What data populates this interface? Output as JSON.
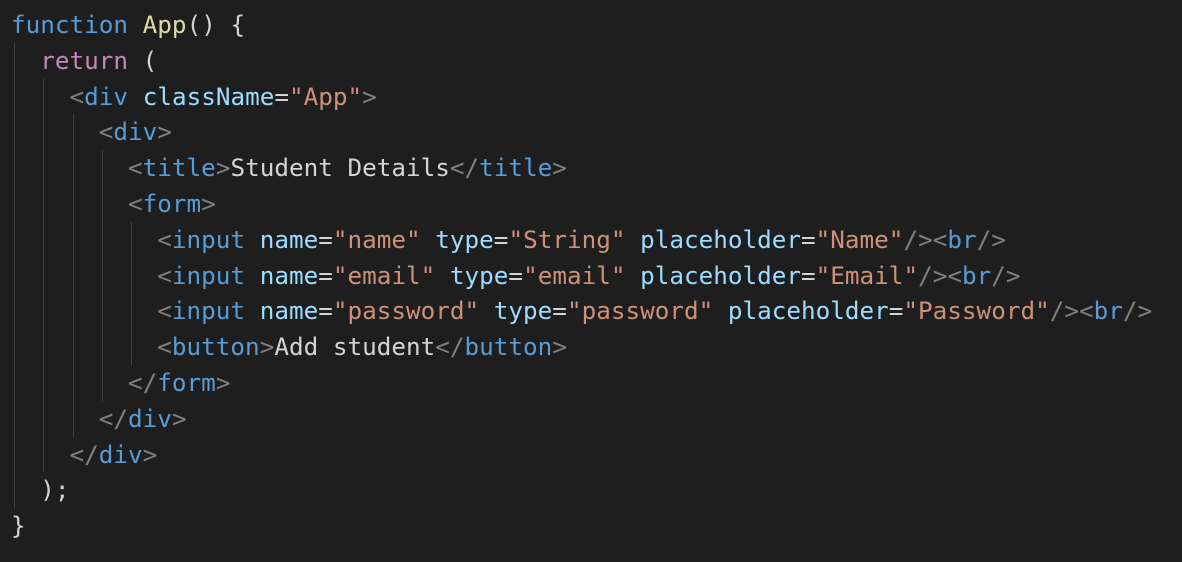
{
  "colors": {
    "background": "#1e1e1e",
    "keyword": "#569cd6",
    "control": "#c586c0",
    "function": "#dcdcaa",
    "plain": "#d4d4d4",
    "punct": "#808080",
    "tag": "#569cd6",
    "attr": "#9cdcfe",
    "string": "#ce9178",
    "text": "#d4d4d4",
    "indent_guide": "#404040"
  },
  "code_lines": [
    {
      "indent": 0,
      "tokens": [
        {
          "t": "keyword",
          "v": "function"
        },
        {
          "t": "plain",
          "v": " "
        },
        {
          "t": "function",
          "v": "App"
        },
        {
          "t": "plain",
          "v": "() {"
        }
      ]
    },
    {
      "indent": 1,
      "tokens": [
        {
          "t": "control",
          "v": "return"
        },
        {
          "t": "plain",
          "v": " ("
        }
      ]
    },
    {
      "indent": 2,
      "tokens": [
        {
          "t": "punct",
          "v": "<"
        },
        {
          "t": "tag",
          "v": "div"
        },
        {
          "t": "plain",
          "v": " "
        },
        {
          "t": "attr",
          "v": "className"
        },
        {
          "t": "plain",
          "v": "="
        },
        {
          "t": "string",
          "v": "\"App\""
        },
        {
          "t": "punct",
          "v": ">"
        }
      ]
    },
    {
      "indent": 3,
      "tokens": [
        {
          "t": "punct",
          "v": "<"
        },
        {
          "t": "tag",
          "v": "div"
        },
        {
          "t": "punct",
          "v": ">"
        }
      ]
    },
    {
      "indent": 4,
      "tokens": [
        {
          "t": "punct",
          "v": "<"
        },
        {
          "t": "tag",
          "v": "title"
        },
        {
          "t": "punct",
          "v": ">"
        },
        {
          "t": "text",
          "v": "Student Details"
        },
        {
          "t": "punct",
          "v": "</"
        },
        {
          "t": "tag",
          "v": "title"
        },
        {
          "t": "punct",
          "v": ">"
        }
      ]
    },
    {
      "indent": 4,
      "tokens": [
        {
          "t": "punct",
          "v": "<"
        },
        {
          "t": "tag",
          "v": "form"
        },
        {
          "t": "punct",
          "v": ">"
        }
      ]
    },
    {
      "indent": 5,
      "tokens": [
        {
          "t": "punct",
          "v": "<"
        },
        {
          "t": "tag",
          "v": "input"
        },
        {
          "t": "plain",
          "v": " "
        },
        {
          "t": "attr",
          "v": "name"
        },
        {
          "t": "plain",
          "v": "="
        },
        {
          "t": "string",
          "v": "\"name\""
        },
        {
          "t": "plain",
          "v": " "
        },
        {
          "t": "attr",
          "v": "type"
        },
        {
          "t": "plain",
          "v": "="
        },
        {
          "t": "string",
          "v": "\"String\""
        },
        {
          "t": "plain",
          "v": " "
        },
        {
          "t": "attr",
          "v": "placeholder"
        },
        {
          "t": "plain",
          "v": "="
        },
        {
          "t": "string",
          "v": "\"Name\""
        },
        {
          "t": "punct",
          "v": "/><"
        },
        {
          "t": "tag",
          "v": "br"
        },
        {
          "t": "punct",
          "v": "/>"
        }
      ]
    },
    {
      "indent": 5,
      "tokens": [
        {
          "t": "punct",
          "v": "<"
        },
        {
          "t": "tag",
          "v": "input"
        },
        {
          "t": "plain",
          "v": " "
        },
        {
          "t": "attr",
          "v": "name"
        },
        {
          "t": "plain",
          "v": "="
        },
        {
          "t": "string",
          "v": "\"email\""
        },
        {
          "t": "plain",
          "v": " "
        },
        {
          "t": "attr",
          "v": "type"
        },
        {
          "t": "plain",
          "v": "="
        },
        {
          "t": "string",
          "v": "\"email\""
        },
        {
          "t": "plain",
          "v": " "
        },
        {
          "t": "attr",
          "v": "placeholder"
        },
        {
          "t": "plain",
          "v": "="
        },
        {
          "t": "string",
          "v": "\"Email\""
        },
        {
          "t": "punct",
          "v": "/><"
        },
        {
          "t": "tag",
          "v": "br"
        },
        {
          "t": "punct",
          "v": "/>"
        }
      ]
    },
    {
      "indent": 5,
      "tokens": [
        {
          "t": "punct",
          "v": "<"
        },
        {
          "t": "tag",
          "v": "input"
        },
        {
          "t": "plain",
          "v": " "
        },
        {
          "t": "attr",
          "v": "name"
        },
        {
          "t": "plain",
          "v": "="
        },
        {
          "t": "string",
          "v": "\"password\""
        },
        {
          "t": "plain",
          "v": " "
        },
        {
          "t": "attr",
          "v": "type"
        },
        {
          "t": "plain",
          "v": "="
        },
        {
          "t": "string",
          "v": "\"password\""
        },
        {
          "t": "plain",
          "v": " "
        },
        {
          "t": "attr",
          "v": "placeholder"
        },
        {
          "t": "plain",
          "v": "="
        },
        {
          "t": "string",
          "v": "\"Password\""
        },
        {
          "t": "punct",
          "v": "/><"
        },
        {
          "t": "tag",
          "v": "br"
        },
        {
          "t": "punct",
          "v": "/>"
        }
      ]
    },
    {
      "indent": 5,
      "tokens": [
        {
          "t": "punct",
          "v": "<"
        },
        {
          "t": "tag",
          "v": "button"
        },
        {
          "t": "punct",
          "v": ">"
        },
        {
          "t": "text",
          "v": "Add student"
        },
        {
          "t": "punct",
          "v": "</"
        },
        {
          "t": "tag",
          "v": "button"
        },
        {
          "t": "punct",
          "v": ">"
        }
      ]
    },
    {
      "indent": 4,
      "tokens": [
        {
          "t": "punct",
          "v": "</"
        },
        {
          "t": "tag",
          "v": "form"
        },
        {
          "t": "punct",
          "v": ">"
        }
      ]
    },
    {
      "indent": 3,
      "tokens": [
        {
          "t": "punct",
          "v": "</"
        },
        {
          "t": "tag",
          "v": "div"
        },
        {
          "t": "punct",
          "v": ">"
        }
      ]
    },
    {
      "indent": 2,
      "tokens": [
        {
          "t": "punct",
          "v": "</"
        },
        {
          "t": "tag",
          "v": "div"
        },
        {
          "t": "punct",
          "v": ">"
        }
      ]
    },
    {
      "indent": 1,
      "tokens": [
        {
          "t": "plain",
          "v": ");"
        }
      ]
    },
    {
      "indent": 0,
      "tokens": [
        {
          "t": "plain",
          "v": "}"
        }
      ]
    }
  ]
}
